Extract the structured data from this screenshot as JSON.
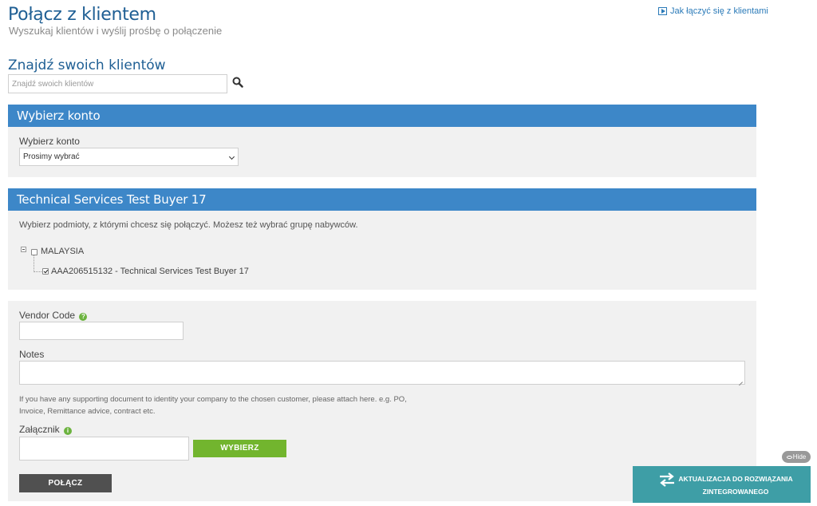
{
  "header": {
    "title": "Połącz z klientem",
    "subtitle": "Wyszukaj klientów i wyślij prośbę o połączenie",
    "help_link": "Jak łączyć się z klientami"
  },
  "search": {
    "heading": "Znajdź swoich klientów",
    "placeholder": "Znajdź swoich klientów"
  },
  "account_panel": {
    "header": "Wybierz konto",
    "label": "Wybierz konto",
    "selected": "Prosimy wybrać"
  },
  "buyer_panel": {
    "header": "Technical Services Test Buyer 17",
    "instructions": "Wybierz podmioty, z którymi chcesz się połączyć. Możesz też wybrać grupę nabywców.",
    "tree": {
      "root": {
        "label": "MALAYSIA",
        "checked": false
      },
      "child": {
        "label": "AAA206515132 - Technical Services Test Buyer 17",
        "checked": true
      }
    }
  },
  "form": {
    "vendor_code_label": "Vendor Code",
    "vendor_code_value": "",
    "notes_label": "Notes",
    "notes_value": "",
    "hint": "If you have any supporting document to identity your company to the chosen customer, please attach here. e.g. PO, Invoice, Remittance advice, contract etc.",
    "attachment_label": "Załącznik",
    "choose_button": "WYBIERZ",
    "connect_button": "POŁĄCZ"
  },
  "widget": {
    "hide_label": "Hide",
    "banner_text": "AKTUALIZACJA DO ROZWIĄZANIA ZINTEGROWANEGO"
  },
  "colors": {
    "header_blue": "#3d87c8",
    "title_blue": "#1f5f94",
    "green": "#72b52e",
    "dark_button": "#505050",
    "teal": "#3e9ea6"
  }
}
